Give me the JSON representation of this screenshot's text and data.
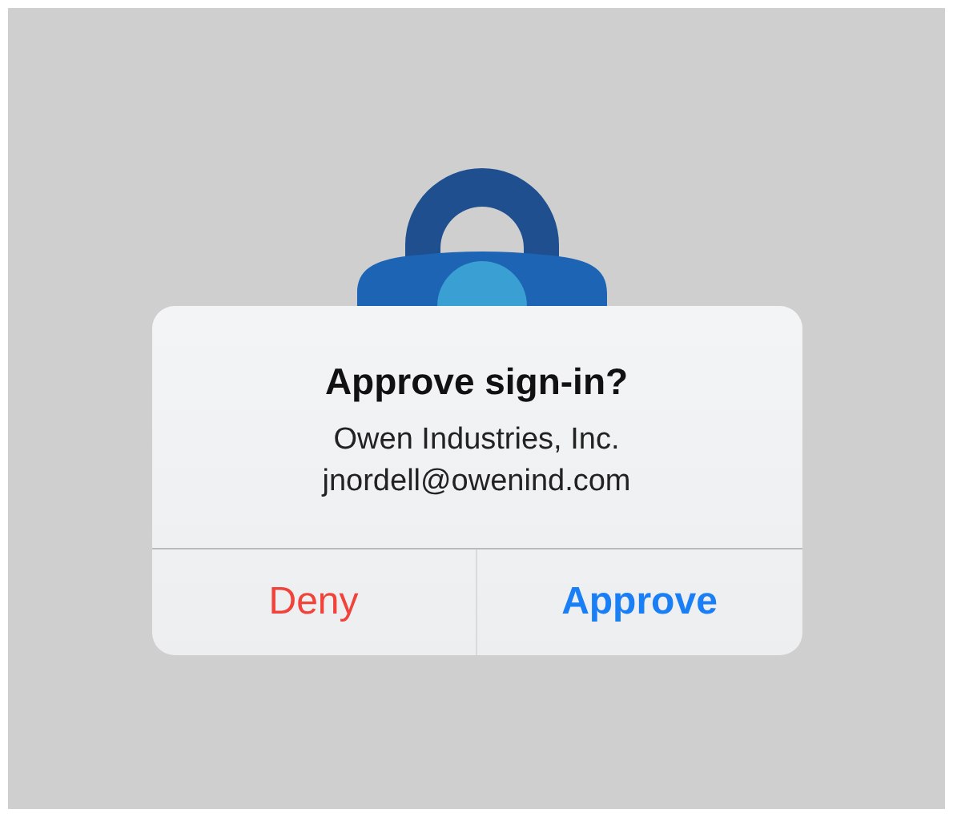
{
  "alert": {
    "title": "Approve sign-in?",
    "lines": [
      "Owen Industries, Inc.",
      "jnordell@owenind.com"
    ],
    "buttons": [
      {
        "label": "Deny",
        "kind": "destructive"
      },
      {
        "label": "Approve",
        "kind": "preferred"
      }
    ]
  }
}
